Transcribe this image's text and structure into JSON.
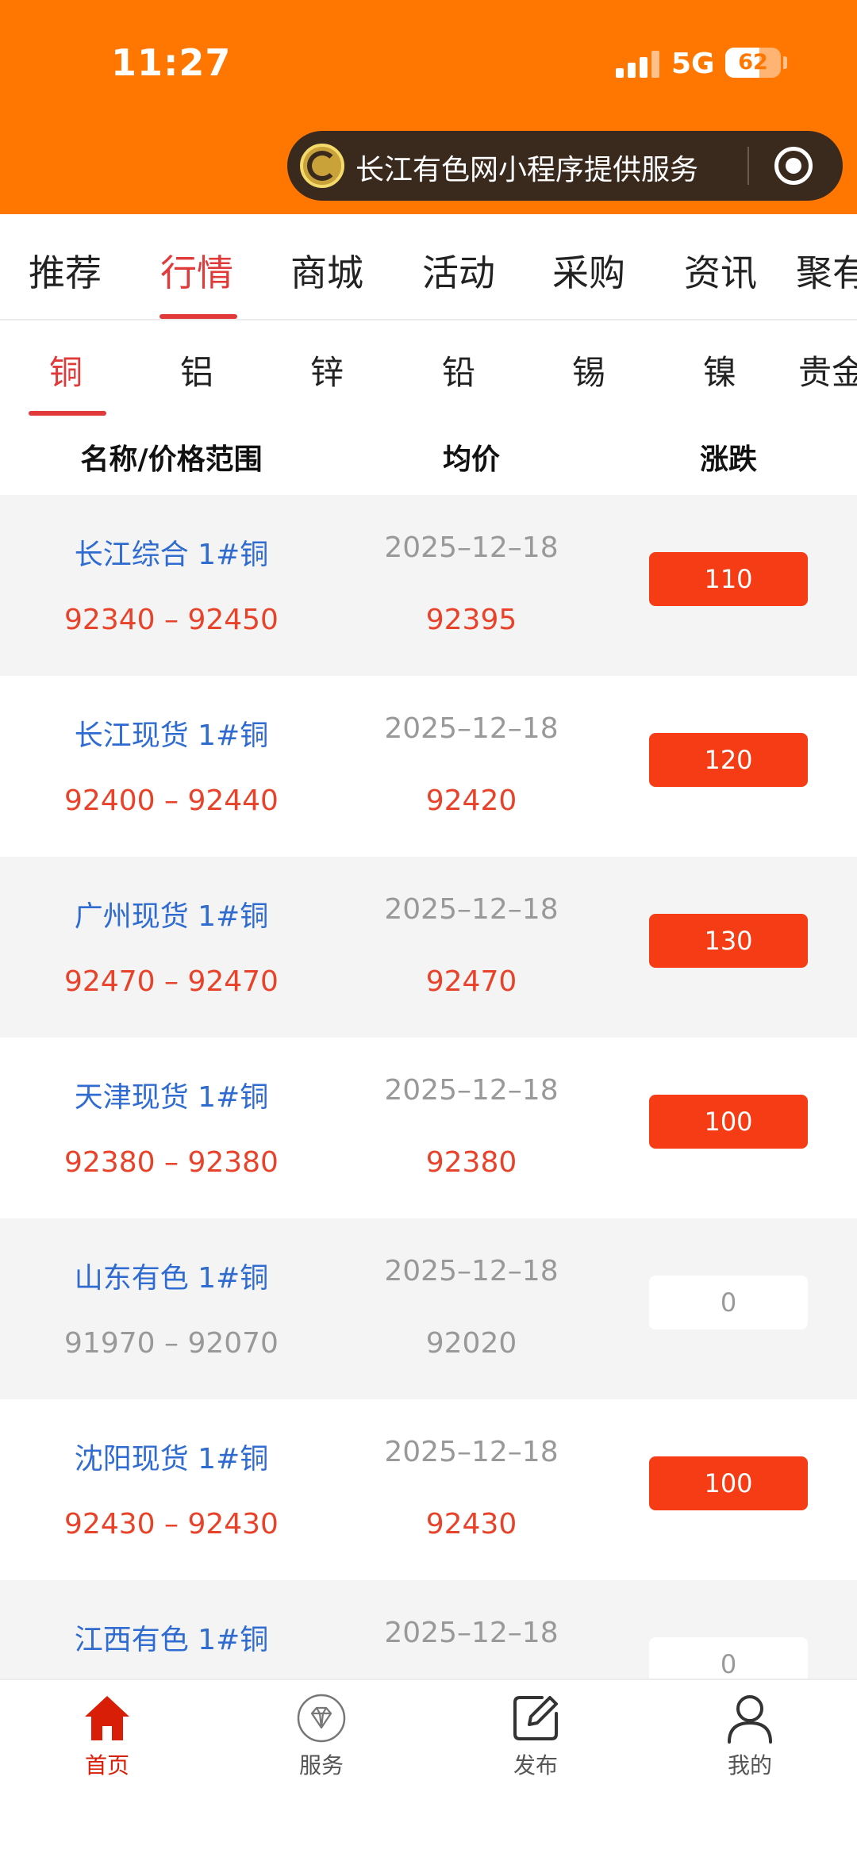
{
  "status_bar": {
    "time": "11:27",
    "network": "5G",
    "battery": "62"
  },
  "mini_program": {
    "text": "长江有色网小程序提供服务"
  },
  "top_tabs": [
    {
      "label": "推荐",
      "active": false
    },
    {
      "label": "行情",
      "active": true
    },
    {
      "label": "商城",
      "active": false
    },
    {
      "label": "活动",
      "active": false
    },
    {
      "label": "采购",
      "active": false
    },
    {
      "label": "资讯",
      "active": false
    },
    {
      "label": "聚有",
      "active": false
    }
  ],
  "metal_tabs": [
    {
      "label": "铜",
      "active": true
    },
    {
      "label": "铝",
      "active": false
    },
    {
      "label": "锌",
      "active": false
    },
    {
      "label": "铅",
      "active": false
    },
    {
      "label": "锡",
      "active": false
    },
    {
      "label": "镍",
      "active": false
    },
    {
      "label": "贵金",
      "active": false
    }
  ],
  "columns": {
    "name": "名称/价格范围",
    "avg": "均价",
    "change": "涨跌"
  },
  "rows": [
    {
      "name": "长江综合 1#铜",
      "range": "92340 – 92450",
      "date": "2025–12–18",
      "avg": "92395",
      "change": "110"
    },
    {
      "name": "长江现货 1#铜",
      "range": "92400 – 92440",
      "date": "2025–12–18",
      "avg": "92420",
      "change": "120"
    },
    {
      "name": "广州现货 1#铜",
      "range": "92470 – 92470",
      "date": "2025–12–18",
      "avg": "92470",
      "change": "130"
    },
    {
      "name": "天津现货 1#铜",
      "range": "92380 – 92380",
      "date": "2025–12–18",
      "avg": "92380",
      "change": "100"
    },
    {
      "name": "山东有色 1#铜",
      "range": "91970 – 92070",
      "date": "2025–12–18",
      "avg": "92020",
      "change": "0"
    },
    {
      "name": "沈阳现货 1#铜",
      "range": "92430 – 92430",
      "date": "2025–12–18",
      "avg": "92430",
      "change": "100"
    },
    {
      "name": "江西有色 1#铜",
      "range": "",
      "date": "2025–12–18",
      "avg": "",
      "change": "0"
    }
  ],
  "bottom_nav": [
    {
      "label": "首页",
      "icon": "home-icon",
      "active": true
    },
    {
      "label": "服务",
      "icon": "diamond-icon",
      "active": false
    },
    {
      "label": "发布",
      "icon": "edit-icon",
      "active": false
    },
    {
      "label": "我的",
      "icon": "user-icon",
      "active": false
    }
  ],
  "colors": {
    "header": "#ff7700",
    "accent": "#e03a3a",
    "up_badge": "#f53c14",
    "name_blue": "#2f6bd0"
  }
}
